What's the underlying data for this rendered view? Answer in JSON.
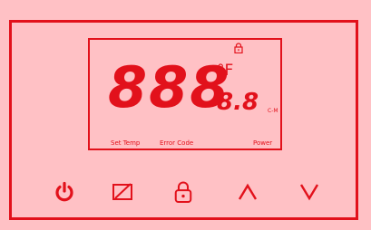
{
  "display": {
    "main_readout": "888",
    "unit": "°F",
    "secondary_readout": "8.8",
    "secondary_unit": "C-M",
    "labels": {
      "set_temp": "Set Temp",
      "error_code": "Error Code",
      "power": "Power"
    }
  },
  "buttons": [
    {
      "name": "power-icon"
    },
    {
      "name": "mode-icon"
    },
    {
      "name": "lock-icon"
    },
    {
      "name": "up-arrow-icon"
    },
    {
      "name": "down-arrow-icon"
    }
  ],
  "colors": {
    "background": "#ffc1c5",
    "accent": "#e2111b"
  }
}
